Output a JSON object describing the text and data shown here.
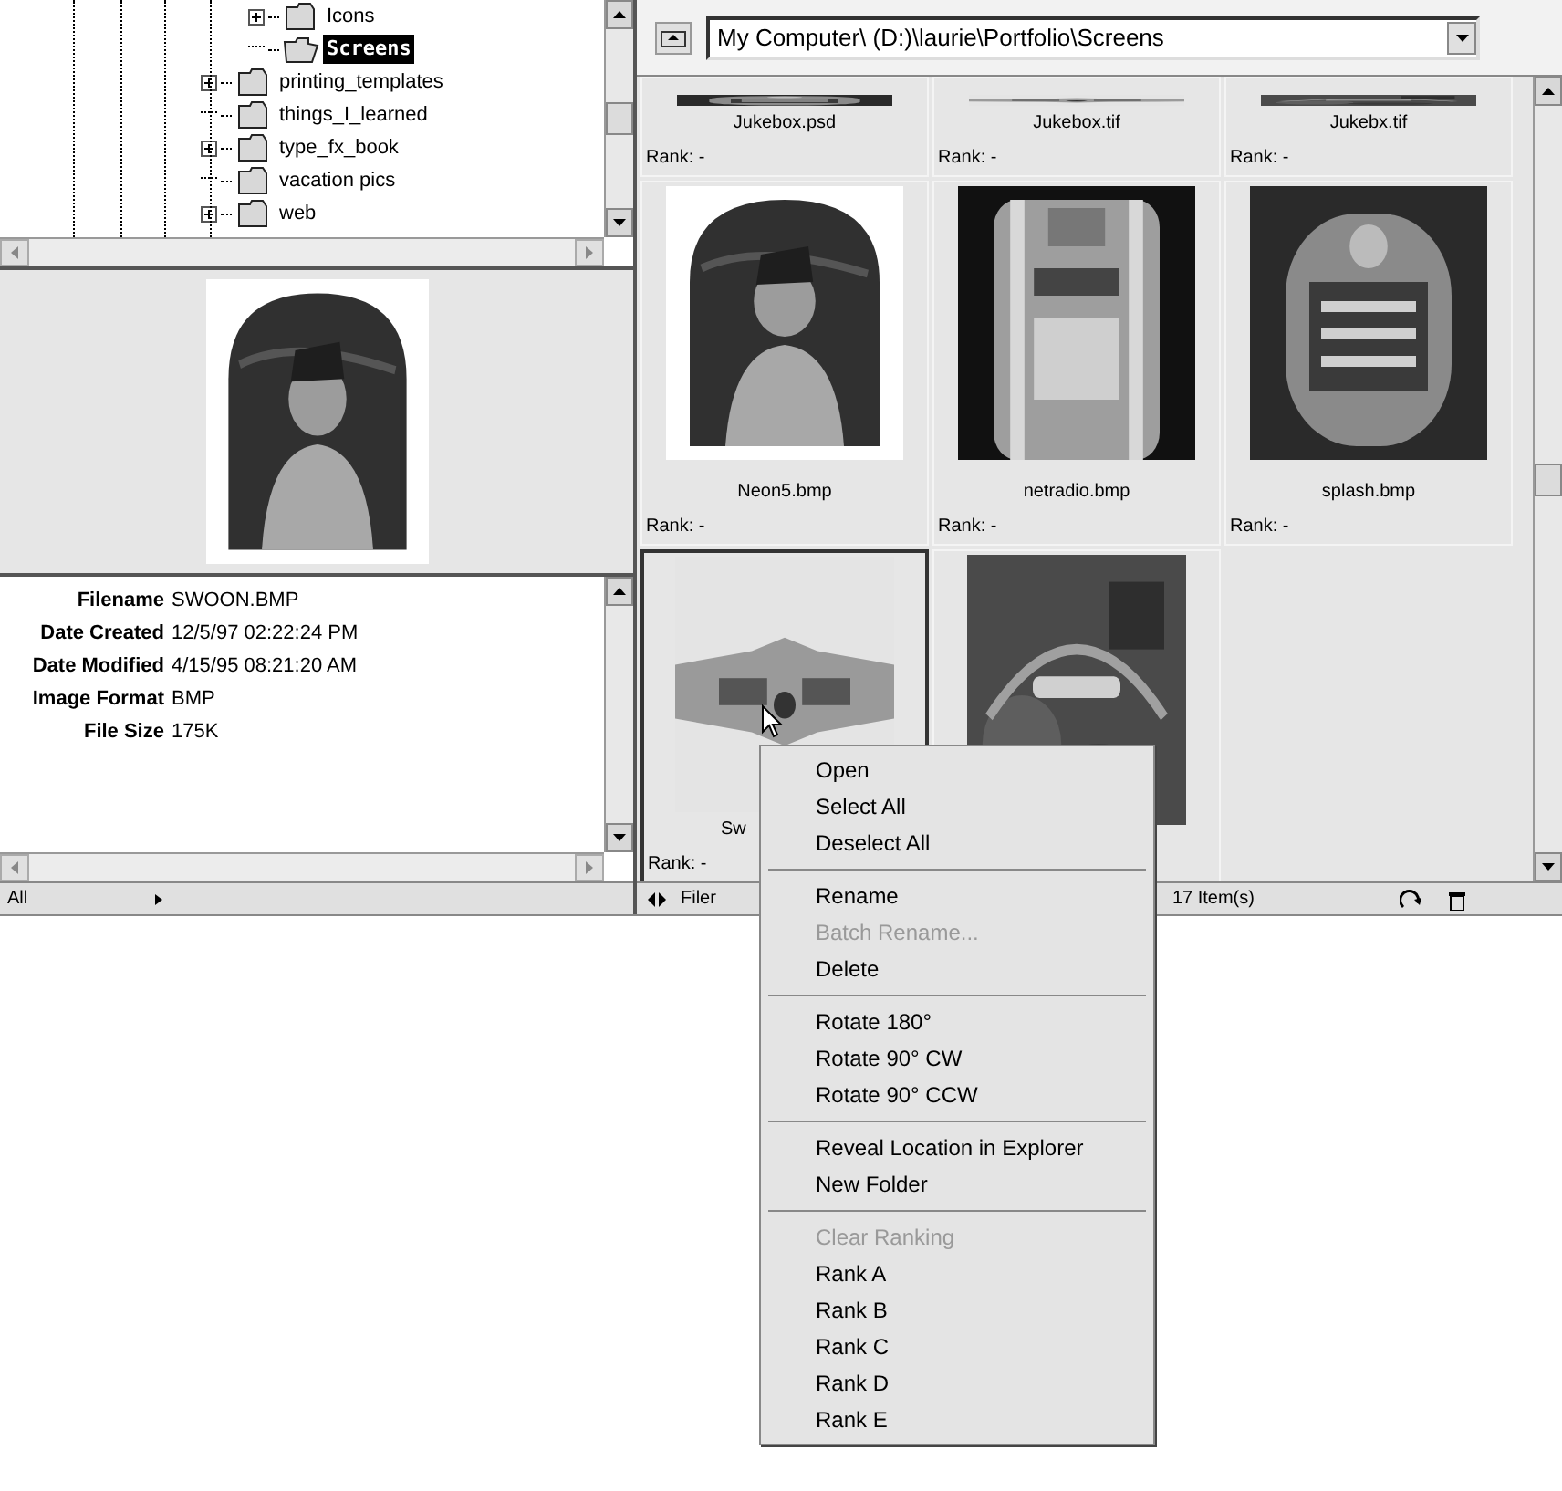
{
  "tree": {
    "nested_items": [
      {
        "label": "Icons",
        "expandable": true,
        "selected": false
      },
      {
        "label": "Screens",
        "expandable": false,
        "selected": true
      }
    ],
    "items": [
      {
        "label": "printing_templates",
        "expandable": true,
        "selected": false
      },
      {
        "label": "things_I_learned",
        "expandable": false,
        "selected": false
      },
      {
        "label": "type_fx_book",
        "expandable": true,
        "selected": false
      },
      {
        "label": "vacation pics",
        "expandable": false,
        "selected": false
      },
      {
        "label": "web",
        "expandable": true,
        "selected": false
      }
    ]
  },
  "info": [
    {
      "label": "Filename",
      "value": "SWOON.BMP"
    },
    {
      "label": "Date Created",
      "value": "12/5/97 02:22:24 PM"
    },
    {
      "label": "Date Modified",
      "value": "4/15/95 08:21:20 AM"
    },
    {
      "label": "Image Format",
      "value": "BMP"
    },
    {
      "label": "File Size",
      "value": "175K"
    }
  ],
  "left_status": {
    "filter": "All"
  },
  "path": "My Computer\\ (D:)\\laurie\\Portfolio\\Screens",
  "thumbnails": [
    {
      "kind": "cut_top",
      "name": "Jukebox.psd",
      "rank": "Rank:  -",
      "selected": false
    },
    {
      "kind": "cut_top",
      "name": "Jukebox.tif",
      "rank": "Rank:  -",
      "selected": false
    },
    {
      "kind": "cut_top",
      "name": "Jukebx.tif",
      "rank": "Rank:  -",
      "selected": false
    },
    {
      "kind": "full",
      "name": "Neon5.bmp",
      "rank": "Rank:  -",
      "selected": false
    },
    {
      "kind": "full",
      "name": "netradio.bmp",
      "rank": "Rank:  -",
      "selected": false
    },
    {
      "kind": "full",
      "name": "splash.bmp",
      "rank": "Rank:  -",
      "selected": false
    },
    {
      "kind": "cut_bottom",
      "name": "Sw",
      "rank": "Rank:  -",
      "selected": true
    },
    {
      "kind": "cut_bottom",
      "selected": false
    }
  ],
  "right_status": {
    "label": "Filer",
    "count": "17 Item(s)"
  },
  "context_menu": [
    {
      "kind": "item",
      "label": "Open",
      "disabled": false
    },
    {
      "kind": "item",
      "label": "Select All",
      "disabled": false
    },
    {
      "kind": "item",
      "label": "Deselect All",
      "disabled": false
    },
    {
      "kind": "separator"
    },
    {
      "kind": "item",
      "label": "Rename",
      "disabled": false
    },
    {
      "kind": "item",
      "label": "Batch Rename...",
      "disabled": true
    },
    {
      "kind": "item",
      "label": "Delete",
      "disabled": false
    },
    {
      "kind": "separator"
    },
    {
      "kind": "item",
      "label": "Rotate 180°",
      "disabled": false
    },
    {
      "kind": "item",
      "label": "Rotate 90° CW",
      "disabled": false
    },
    {
      "kind": "item",
      "label": "Rotate 90° CCW",
      "disabled": false
    },
    {
      "kind": "separator"
    },
    {
      "kind": "item",
      "label": "Reveal Location in Explorer",
      "disabled": false
    },
    {
      "kind": "item",
      "label": "New Folder",
      "disabled": false
    },
    {
      "kind": "separator"
    },
    {
      "kind": "item",
      "label": "Clear Ranking",
      "disabled": true
    },
    {
      "kind": "item",
      "label": "Rank A",
      "disabled": false
    },
    {
      "kind": "item",
      "label": "Rank B",
      "disabled": false
    },
    {
      "kind": "item",
      "label": "Rank C",
      "disabled": false
    },
    {
      "kind": "item",
      "label": "Rank D",
      "disabled": false
    },
    {
      "kind": "item",
      "label": "Rank E",
      "disabled": false
    }
  ]
}
